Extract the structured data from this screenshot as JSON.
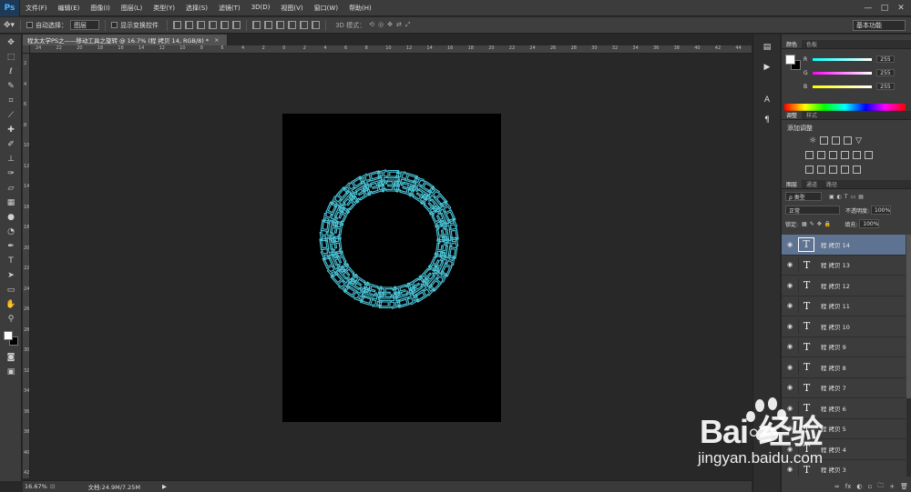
{
  "app": {
    "logo": "Ps"
  },
  "menu": [
    "文件(F)",
    "编辑(E)",
    "图像(I)",
    "图层(L)",
    "类型(Y)",
    "选择(S)",
    "滤镜(T)",
    "3D(D)",
    "视图(V)",
    "窗口(W)",
    "帮助(H)"
  ],
  "window_controls": [
    "—",
    "□",
    "✕"
  ],
  "options": {
    "auto_select_label": "自动选择：",
    "auto_select_value": "图层",
    "show_transform_label": "显示变换控件",
    "mode3d_label": "3D 模式："
  },
  "workspace": "基本功能",
  "document": {
    "tab_title": "程太太学PS之——移动工具之旋转 @ 16.7% (程 拷贝 14, RGB/8) *",
    "close": "×",
    "ring_char": "程",
    "ring_color": "#4dc8dc"
  },
  "ruler_top_labels": [
    "24",
    "22",
    "20",
    "18",
    "16",
    "14",
    "12",
    "10",
    "8",
    "6",
    "4",
    "2",
    "0",
    "2",
    "4",
    "6",
    "8",
    "10",
    "12",
    "14",
    "16",
    "18",
    "20",
    "22",
    "24",
    "26",
    "28",
    "30",
    "32",
    "34",
    "36",
    "38",
    "40",
    "42",
    "44"
  ],
  "ruler_left_labels": [
    "2",
    "4",
    "6",
    "8",
    "10",
    "12",
    "14",
    "16",
    "18",
    "20",
    "22",
    "24",
    "26",
    "28",
    "30",
    "32",
    "34",
    "36",
    "38",
    "40",
    "42"
  ],
  "status": {
    "zoom": "16.67%",
    "doc": "文档:24.9M/7.25M",
    "arrow": "▶"
  },
  "color_panel": {
    "tabs": [
      "颜色",
      "色板"
    ],
    "sliders": [
      {
        "letter": "R",
        "value": "255",
        "color": "#ff5a5a"
      },
      {
        "letter": "G",
        "value": "255",
        "color": "#5aff6a"
      },
      {
        "letter": "B",
        "value": "255",
        "color": "#5a8cff"
      }
    ]
  },
  "adjustments_panel": {
    "tabs": [
      "调整",
      "样式"
    ],
    "title": "添加调整"
  },
  "layers_panel": {
    "tabs": [
      "图层",
      "通道",
      "路径"
    ],
    "filter_label": "ρ 类型",
    "blend_mode": "正常",
    "opacity_label": "不透明度:",
    "opacity_value": "100%",
    "lock_label": "锁定:",
    "fill_label": "填充:",
    "fill_value": "100%",
    "layers": [
      {
        "name": "程 拷贝 14",
        "selected": true
      },
      {
        "name": "程 拷贝 13",
        "selected": false
      },
      {
        "name": "程 拷贝 12",
        "selected": false
      },
      {
        "name": "程 拷贝 11",
        "selected": false
      },
      {
        "name": "程 拷贝 10",
        "selected": false
      },
      {
        "name": "程 拷贝 9",
        "selected": false
      },
      {
        "name": "程 拷贝 8",
        "selected": false
      },
      {
        "name": "程 拷贝 7",
        "selected": false
      },
      {
        "name": "程 拷贝 6",
        "selected": false
      },
      {
        "name": "程 拷贝 5",
        "selected": false
      },
      {
        "name": "程 拷贝 4",
        "selected": false
      },
      {
        "name": "程 拷贝 3",
        "selected": false
      }
    ],
    "thumb_glyph": "T",
    "eye_glyph": "◉",
    "footer_icons": [
      "∞",
      "fx",
      "◐",
      "▫",
      "🗀",
      "+",
      "🗑"
    ]
  },
  "watermark": {
    "text": "Bai◦经验",
    "url": "jingyan.baidu.com"
  }
}
